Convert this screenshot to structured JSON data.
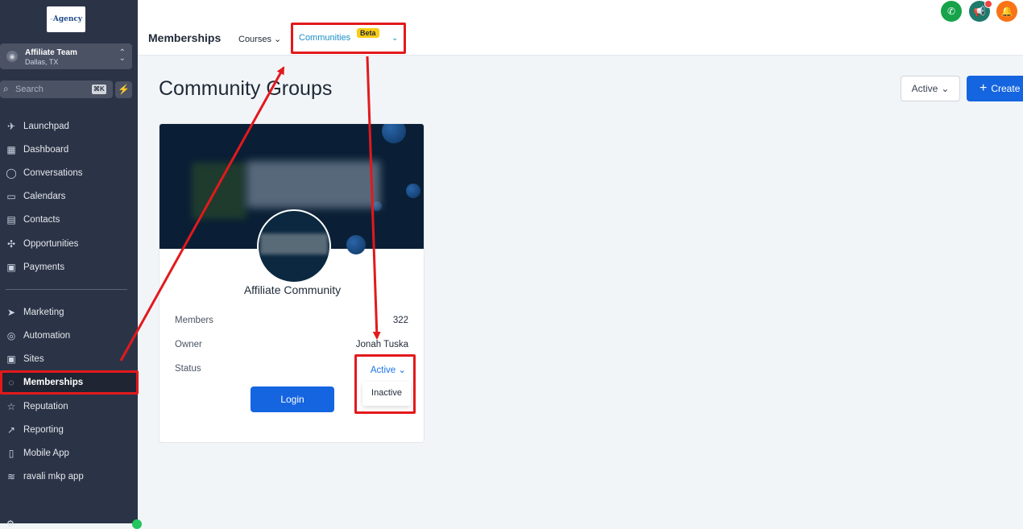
{
  "sidebar": {
    "logo_text": "Agency",
    "account": {
      "name": "Affiliate Team",
      "location": "Dallas, TX"
    },
    "search": {
      "placeholder": "Search",
      "shortcut": "⌘K"
    },
    "items": [
      {
        "label": "Launchpad",
        "icon": "rocket-icon"
      },
      {
        "label": "Dashboard",
        "icon": "grid-icon"
      },
      {
        "label": "Conversations",
        "icon": "chat-icon"
      },
      {
        "label": "Calendars",
        "icon": "calendar-icon"
      },
      {
        "label": "Contacts",
        "icon": "contacts-icon"
      },
      {
        "label": "Opportunities",
        "icon": "funnel-icon"
      },
      {
        "label": "Payments",
        "icon": "payments-icon"
      },
      {
        "label": "Marketing",
        "icon": "send-icon"
      },
      {
        "label": "Automation",
        "icon": "automation-icon"
      },
      {
        "label": "Sites",
        "icon": "sites-icon"
      },
      {
        "label": "Memberships",
        "icon": "badge-icon",
        "active": true
      },
      {
        "label": "Reputation",
        "icon": "star-icon"
      },
      {
        "label": "Reporting",
        "icon": "trend-icon"
      },
      {
        "label": "Mobile App",
        "icon": "mobile-icon"
      },
      {
        "label": "ravali mkp app",
        "icon": "waves-icon"
      }
    ]
  },
  "topbar": {
    "title": "Memberships",
    "tabs": {
      "courses": "Courses",
      "communities": "Communities",
      "beta": "Beta"
    }
  },
  "main": {
    "title": "Community Groups",
    "filter_label": "Active",
    "create_label": "Create"
  },
  "card": {
    "name": "Affiliate Community",
    "members_label": "Members",
    "members_value": "322",
    "owner_label": "Owner",
    "owner_value": "Jonah Tuska",
    "status_label": "Status",
    "status_value": "Active",
    "status_options": [
      "Inactive"
    ],
    "login_label": "Login"
  },
  "colors": {
    "sidebar_bg": "#2b3447",
    "primary": "#1565e0",
    "annotation": "#e3191c",
    "link": "#1a8fc9"
  }
}
